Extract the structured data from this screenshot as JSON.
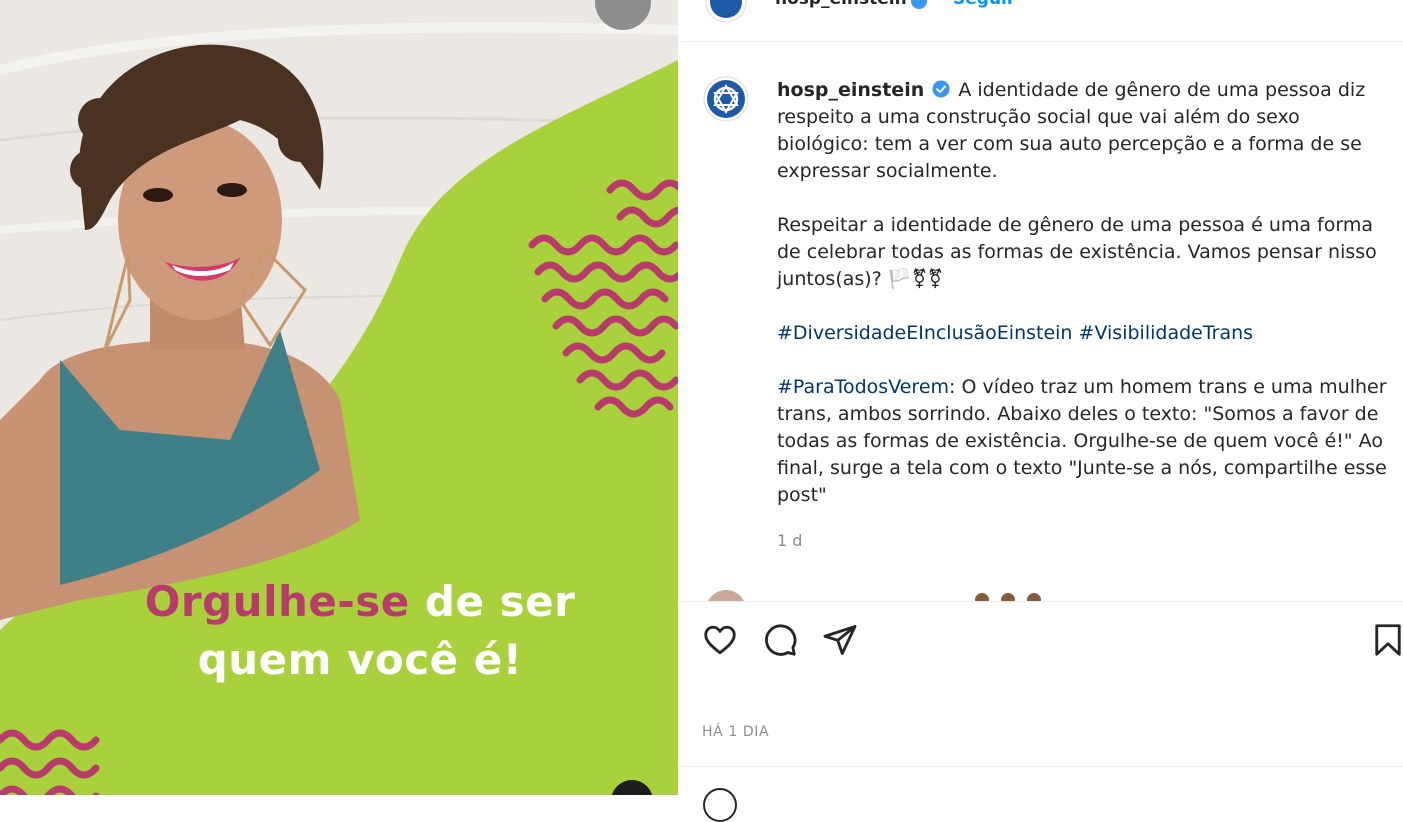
{
  "post": {
    "media": {
      "headline_part1": "Orgulhe-se",
      "headline_part2": " de ser",
      "headline_line2": "quem você é!"
    },
    "header": {
      "username": "hosp_einstein",
      "follow_label": "Seguir"
    },
    "caption": {
      "username": "hosp_einstein",
      "paragraph1": "A identidade de gênero de uma pessoa diz respeito a uma construção social que vai além do sexo biológico: tem a ver com sua auto percepção e a forma de se expressar socialmente.",
      "paragraph2": "Respeitar a identidade de gênero de uma pessoa é uma forma de celebrar todas as formas de existência. Vamos pensar nisso juntos(as)? 🏳️⚧⚧",
      "hashtag1": "#DiversidadeEInclusãoEinstein",
      "hashtag2": "#VisibilidadeTrans",
      "hashtag3": "#ParaTodosVerem",
      "paragraph4": ": O vídeo traz um homem trans e uma mulher trans, ambos sorrindo. Abaixo deles o texto: \"Somos a favor de todas as formas de existência. Orgulhe-se de quem você é!\" Ao final, surge a tela com o texto \"Junte-se a nós, compartilhe esse post\""
    },
    "relative_time": "1 d",
    "date_label": "HÁ 1 DIA"
  },
  "icons": {
    "like": "heart-icon",
    "comment": "comment-icon",
    "share": "send-icon",
    "save": "bookmark-icon"
  },
  "colors": {
    "brand_green": "#a9d13b",
    "brand_pink": "#b83b6c",
    "link": "#00376b",
    "follow": "#0095f6",
    "muted": "#8e8e8e",
    "verified": "#3897f0"
  }
}
